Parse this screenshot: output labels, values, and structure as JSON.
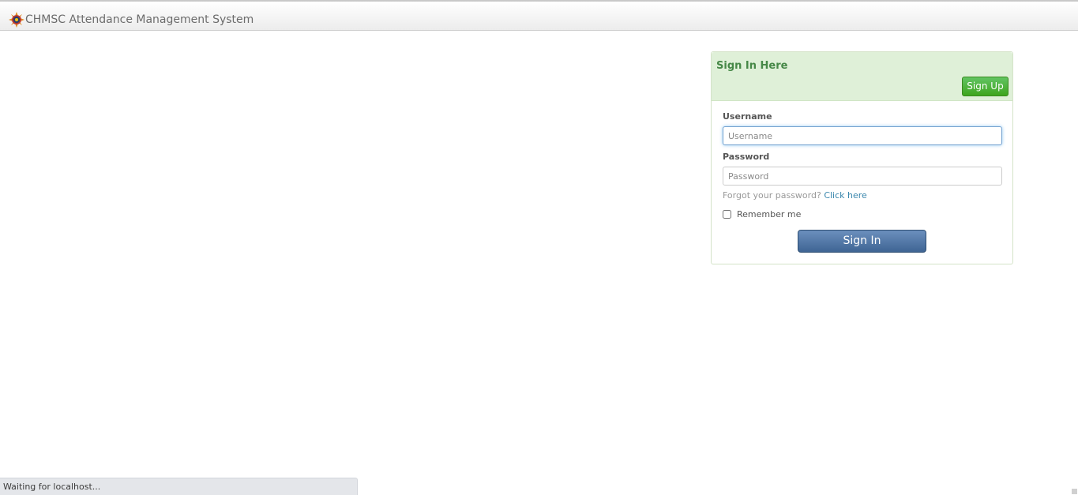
{
  "navbar": {
    "logo_icon": "sunburst-logo-icon",
    "title": "CHMSC Attendance Management System"
  },
  "login": {
    "heading": "Sign In Here",
    "signup_label": "Sign Up",
    "username_label": "Username",
    "username_placeholder": "Username",
    "password_label": "Password",
    "password_placeholder": "Password",
    "forgot_text": "Forgot your password?",
    "forgot_link": "Click here",
    "remember_label": "Remember me",
    "remember_checked": false,
    "signin_label": "Sign In"
  },
  "status_bar": {
    "text": "Waiting for localhost..."
  },
  "colors": {
    "panel_heading_bg": "#dff0d8",
    "panel_heading_text": "#468847",
    "signup_button": "#3ea51d",
    "signin_button": "#4a6fa0",
    "link": "#3a87ad"
  }
}
